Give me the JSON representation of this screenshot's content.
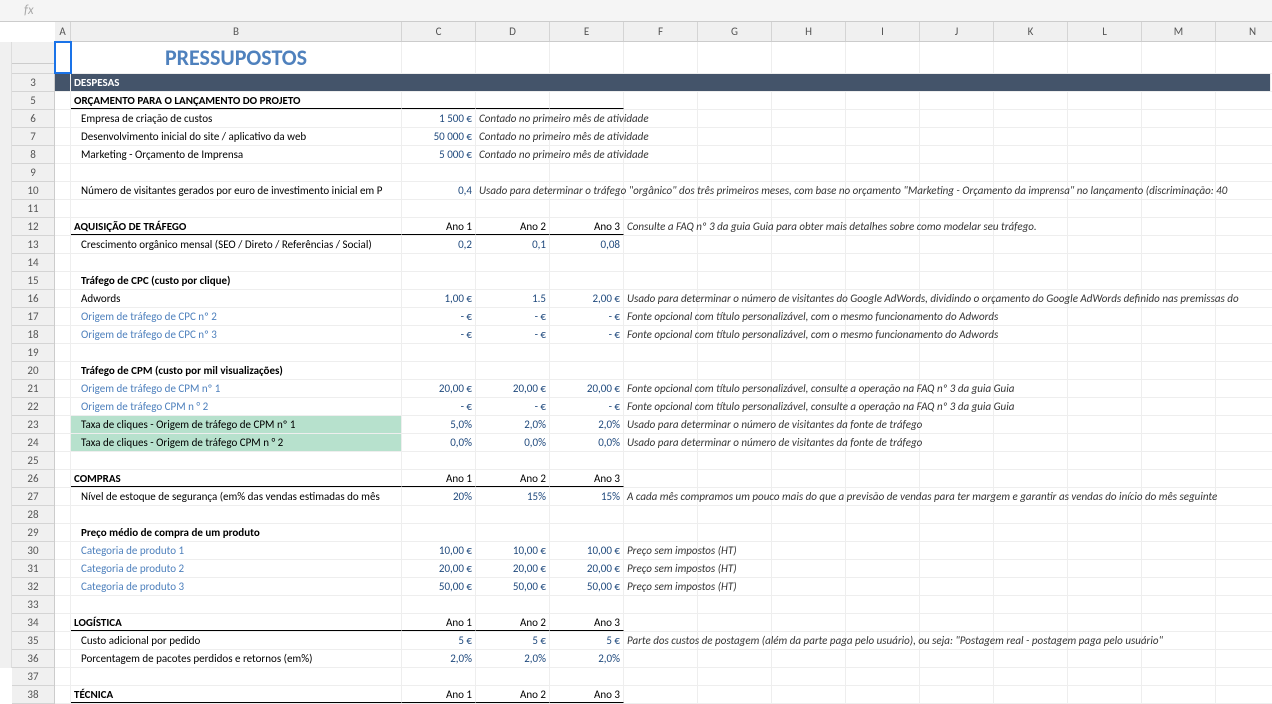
{
  "fx": "fx",
  "columns": [
    "A",
    "B",
    "C",
    "D",
    "E",
    "F",
    "G",
    "H",
    "I",
    "J",
    "K",
    "L",
    "M",
    "N"
  ],
  "colWidths": {
    "A": 16,
    "B": 331,
    "C": 74,
    "D": 74,
    "E": 74,
    "F": 74,
    "G": 74,
    "H": 74,
    "I": 74,
    "J": 74,
    "K": 74,
    "L": 74,
    "M": 74,
    "N": 74
  },
  "rowNumbers": [
    1,
    3,
    5,
    6,
    7,
    8,
    9,
    10,
    11,
    12,
    13,
    14,
    15,
    16,
    17,
    18,
    19,
    20,
    21,
    22,
    23,
    24,
    25,
    26,
    27,
    28,
    29,
    30,
    31,
    32,
    33,
    34,
    35,
    36,
    37,
    38
  ],
  "title": "PRESSUPOSTOS",
  "despesas": "DESPESAS",
  "orcamento": {
    "header": "ORÇAMENTO PARA O LANÇAMENTO DO PROJETO",
    "r6": {
      "b": "Empresa de criação de custos",
      "c": "1 500 €",
      "d": "Contado no primeiro mês de atividade"
    },
    "r7": {
      "b": "Desenvolvimento inicial do site / aplicativo da web",
      "c": "50 000 €",
      "d": "Contado no primeiro mês de atividade"
    },
    "r8": {
      "b": "Marketing - Orçamento de Imprensa",
      "c": "5 000 €",
      "d": "Contado no primeiro mês de atividade"
    },
    "r10": {
      "b": "Número de visitantes gerados por euro de investimento inicial em P",
      "c": "0,4",
      "d": "Usado para determinar o tráfego \"orgânico\" dos três primeiros meses, com base no orçamento \"Marketing - Orçamento da imprensa\" no lançamento (discriminação: 40"
    }
  },
  "aquisicao": {
    "header": "AQUISIÇÃO DE TRÁFEGO",
    "y1": "Ano 1",
    "y2": "Ano 2",
    "y3": "Ano 3",
    "note": "Consulte a FAQ nº 3 da guia Guia para obter mais detalhes sobre como modelar seu tráfego.",
    "r13": {
      "b": "Crescimento orgânico mensal (SEO / Direto / Referências / Social)",
      "c": "0,2",
      "d": "0,1",
      "e": "0,08"
    },
    "r15": "Tráfego de CPC (custo por clique)",
    "r16": {
      "b": "Adwords",
      "c": "1,00 €",
      "d": "1.5",
      "e": "2,00 €",
      "f": "Usado para determinar o número de visitantes do Google AdWords, dividindo o orçamento do Google AdWords definido nas premissas do"
    },
    "r17": {
      "b": "Origem de tráfego de CPC nº 2",
      "c": "-   €",
      "d": "-   €",
      "e": "-   €",
      "f": "Fonte opcional com título personalizável, com o mesmo funcionamento do Adwords"
    },
    "r18": {
      "b": "Origem de tráfego de CPC nº 3",
      "c": "-   €",
      "d": "-   €",
      "e": "-   €",
      "f": "Fonte opcional com título personalizável, com o mesmo funcionamento do Adwords"
    },
    "r20": "Tráfego de CPM (custo por mil visualizações)",
    "r21": {
      "b": "Origem de tráfego de CPM nº 1",
      "c": "20,00 €",
      "d": "20,00 €",
      "e": "20,00 €",
      "f": "Fonte opcional com título personalizável, consulte a operação na FAQ nº 3 da guia Guia"
    },
    "r22": {
      "b": "Origem de tráfego CPM n ° 2",
      "c": "-   €",
      "d": "-   €",
      "e": "-   €",
      "f": "Fonte opcional com título personalizável, consulte a operação na FAQ nº 3 da guia Guia"
    },
    "r23": {
      "b": "Taxa de cliques - Origem de tráfego de CPM nº 1",
      "c": "5,0%",
      "d": "2,0%",
      "e": "2,0%",
      "f": "Usado para determinar o número de visitantes da fonte de tráfego"
    },
    "r24": {
      "b": "Taxa de cliques - Origem de tráfego CPM n ° 2",
      "c": "0,0%",
      "d": "0,0%",
      "e": "0,0%",
      "f": "Usado para determinar o número de visitantes da fonte de tráfego"
    }
  },
  "compras": {
    "header": "COMPRAS",
    "y1": "Ano 1",
    "y2": "Ano 2",
    "y3": "Ano 3",
    "r27": {
      "b": "Nível de estoque de segurança (em% das vendas estimadas do mês",
      "c": "20%",
      "d": "15%",
      "e": "15%",
      "f": "A cada mês compramos um pouco mais do que a previsão de vendas para ter margem e garantir as vendas do início do mês seguinte"
    },
    "r29": "Preço médio de compra de um produto",
    "r30": {
      "b": "Categoria de produto 1",
      "c": "10,00 €",
      "d": "10,00 €",
      "e": "10,00 €",
      "f": "Preço sem impostos (HT)"
    },
    "r31": {
      "b": "Categoria de produto 2",
      "c": "20,00 €",
      "d": "20,00 €",
      "e": "20,00 €",
      "f": "Preço sem impostos (HT)"
    },
    "r32": {
      "b": "Categoria de produto 3",
      "c": "50,00 €",
      "d": "50,00 €",
      "e": "50,00 €",
      "f": "Preço sem impostos (HT)"
    }
  },
  "logistica": {
    "header": "LOGÍSTICA",
    "y1": "Ano 1",
    "y2": "Ano 2",
    "y3": "Ano 3",
    "r35": {
      "b": "Custo adicional por pedido",
      "c": "5 €",
      "d": "5 €",
      "e": "5 €",
      "f": "Parte dos custos de postagem (além da parte paga pelo usuário), ou seja: \"Postagem real - postagem paga pelo usuário\""
    },
    "r36": {
      "b": "Porcentagem de pacotes perdidos e retornos (em%)",
      "c": "2,0%",
      "d": "2,0%",
      "e": "2,0%"
    }
  },
  "tecnica": {
    "header": "TÉCNICA",
    "y1": "Ano 1",
    "y2": "Ano 2",
    "y3": "Ano 3"
  }
}
